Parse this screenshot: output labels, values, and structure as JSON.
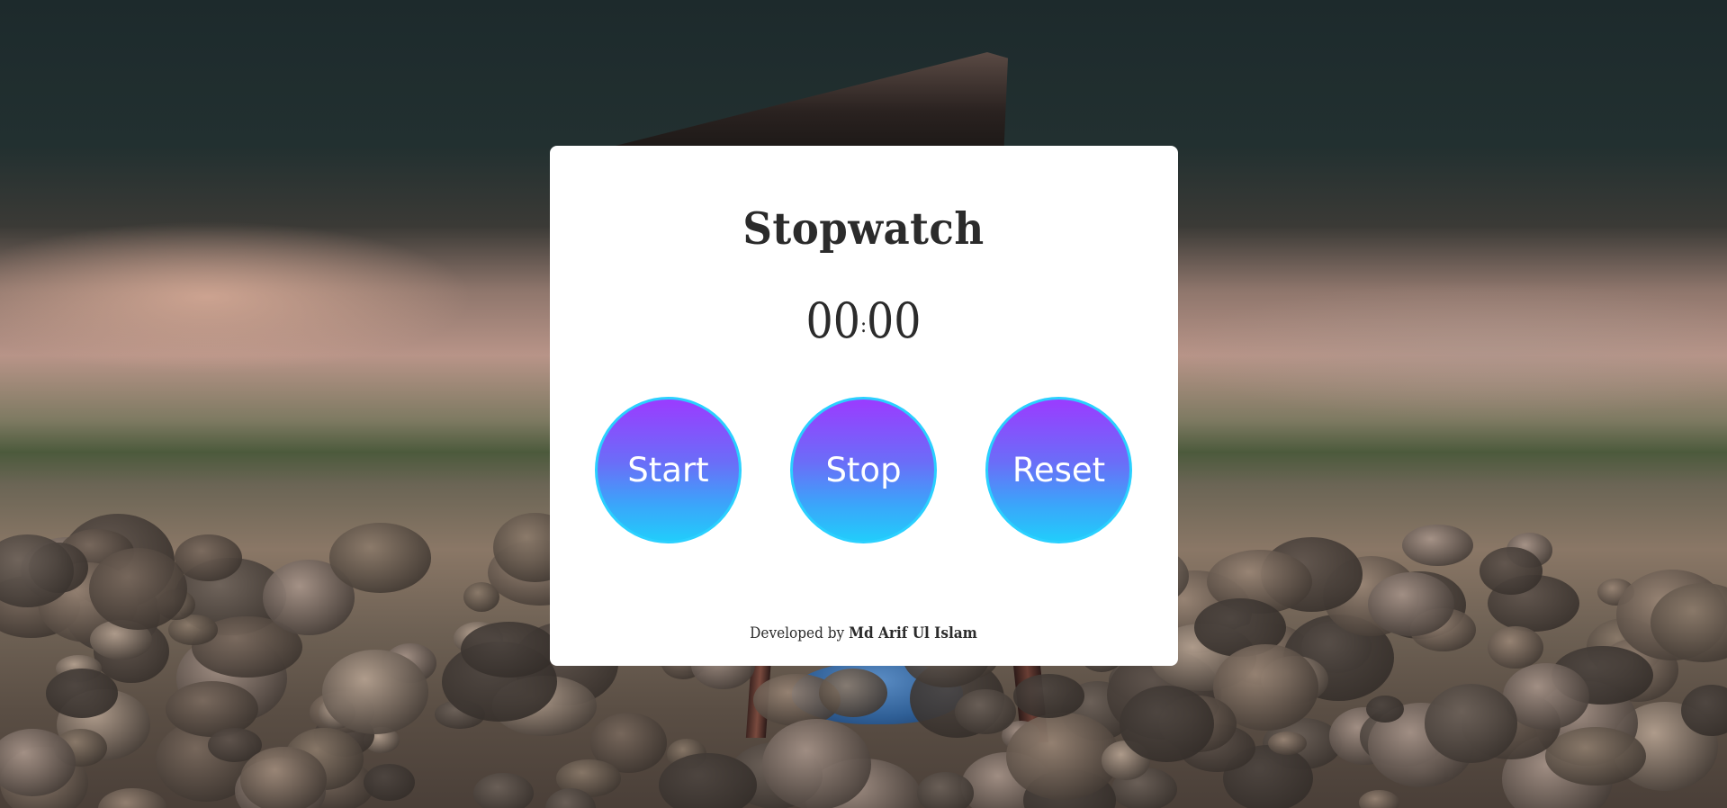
{
  "app": {
    "title": "Stopwatch",
    "time_minutes": "00",
    "time_separator": ":",
    "time_seconds": "00"
  },
  "buttons": {
    "start_label": "Start",
    "stop_label": "Stop",
    "reset_label": "Reset"
  },
  "footer": {
    "prefix": "Developed by",
    "author": "Md Arif Ul Islam"
  },
  "colors": {
    "button_gradient_top": "#9b3bff",
    "button_gradient_bottom": "#22ccfb",
    "button_border": "#2ad0ff",
    "card_background": "#ffffff",
    "text": "#2b2b2b"
  }
}
